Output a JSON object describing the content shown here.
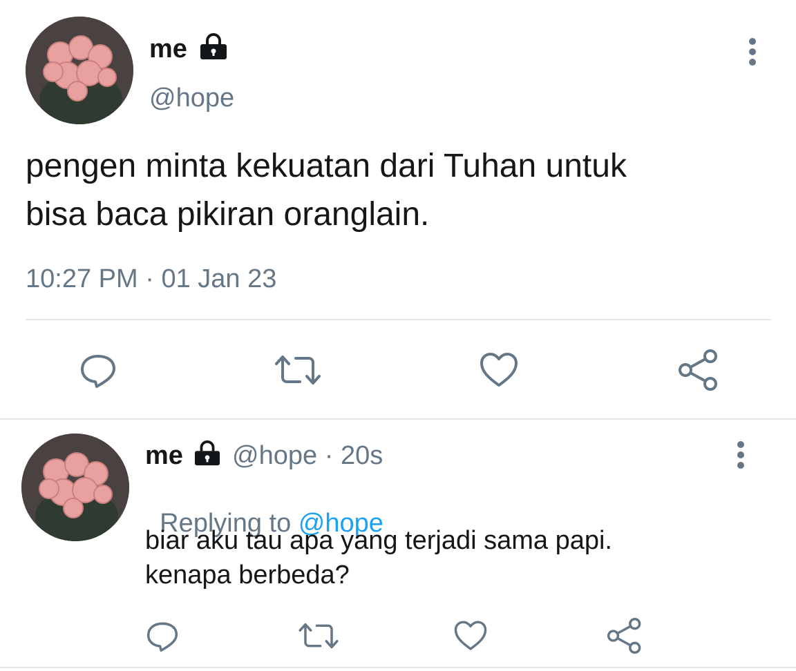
{
  "tweet": {
    "display_name": "me",
    "handle": "@hope",
    "text_line1": "pengen minta kekuatan dari Tuhan untuk",
    "text_line2": "bisa baca pikiran oranglain.",
    "time": "10:27 PM",
    "date": "01 Jan 23",
    "separator": "·"
  },
  "reply": {
    "display_name": "me",
    "handle": "@hope",
    "separator": "·",
    "age": "20s",
    "replying_prefix": "Replying to ",
    "replying_handle": "@hope",
    "text_line1": "biar aku tau apa yang terjadi sama papi.",
    "text_line2": "kenapa berbeda?"
  },
  "icons": [
    "lock-icon",
    "more-vertical-icon",
    "reply-icon",
    "retweet-icon",
    "like-icon",
    "share-icon"
  ],
  "colors": {
    "text": "#14171a",
    "secondary": "#657786",
    "link": "#1da1f2",
    "divider": "#e1e8ed"
  }
}
